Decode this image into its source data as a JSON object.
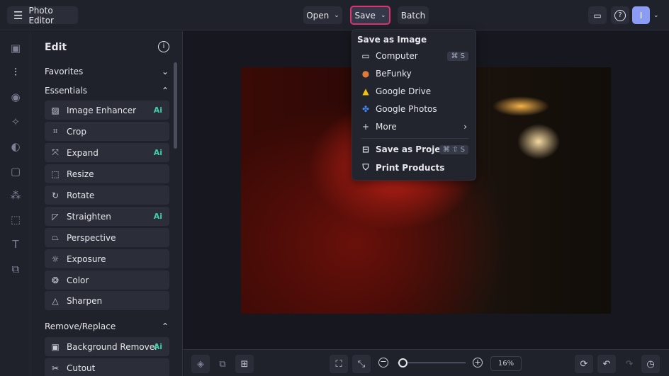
{
  "header": {
    "app_title": "Photo Editor",
    "open_label": "Open",
    "save_label": "Save",
    "batch_label": "Batch",
    "avatar_initial": "I"
  },
  "panel": {
    "title": "Edit",
    "sections": [
      {
        "label": "Favorites"
      },
      {
        "label": "Essentials"
      },
      {
        "label": "Remove/Replace"
      }
    ],
    "items": [
      {
        "label": "Image Enhancer",
        "ai": "Ai"
      },
      {
        "label": "Crop"
      },
      {
        "label": "Expand",
        "ai": "Ai"
      },
      {
        "label": "Resize"
      },
      {
        "label": "Rotate"
      },
      {
        "label": "Straighten",
        "ai": "Ai"
      },
      {
        "label": "Perspective"
      },
      {
        "label": "Exposure"
      },
      {
        "label": "Color"
      },
      {
        "label": "Sharpen"
      }
    ],
    "remove_items": [
      {
        "label": "Background Remover",
        "ai": "Ai"
      },
      {
        "label": "Cutout"
      }
    ]
  },
  "save_menu": {
    "heading": "Save as Image",
    "items": [
      {
        "label": "Computer",
        "shortcut": "⌘ S"
      },
      {
        "label": "BeFunky"
      },
      {
        "label": "Google Drive"
      },
      {
        "label": "Google Photos"
      },
      {
        "label": "More"
      }
    ],
    "project": {
      "label": "Save as Project",
      "shortcut": "⌘ ⇧ S"
    },
    "print": {
      "label": "Print Products"
    }
  },
  "bottom": {
    "zoom": "16%",
    "zoom_fraction": 0.03
  },
  "colors": {
    "accent_highlight": "#e0336f",
    "ai_badge": "#3fd1a6",
    "avatar": "#8c9cf5"
  }
}
